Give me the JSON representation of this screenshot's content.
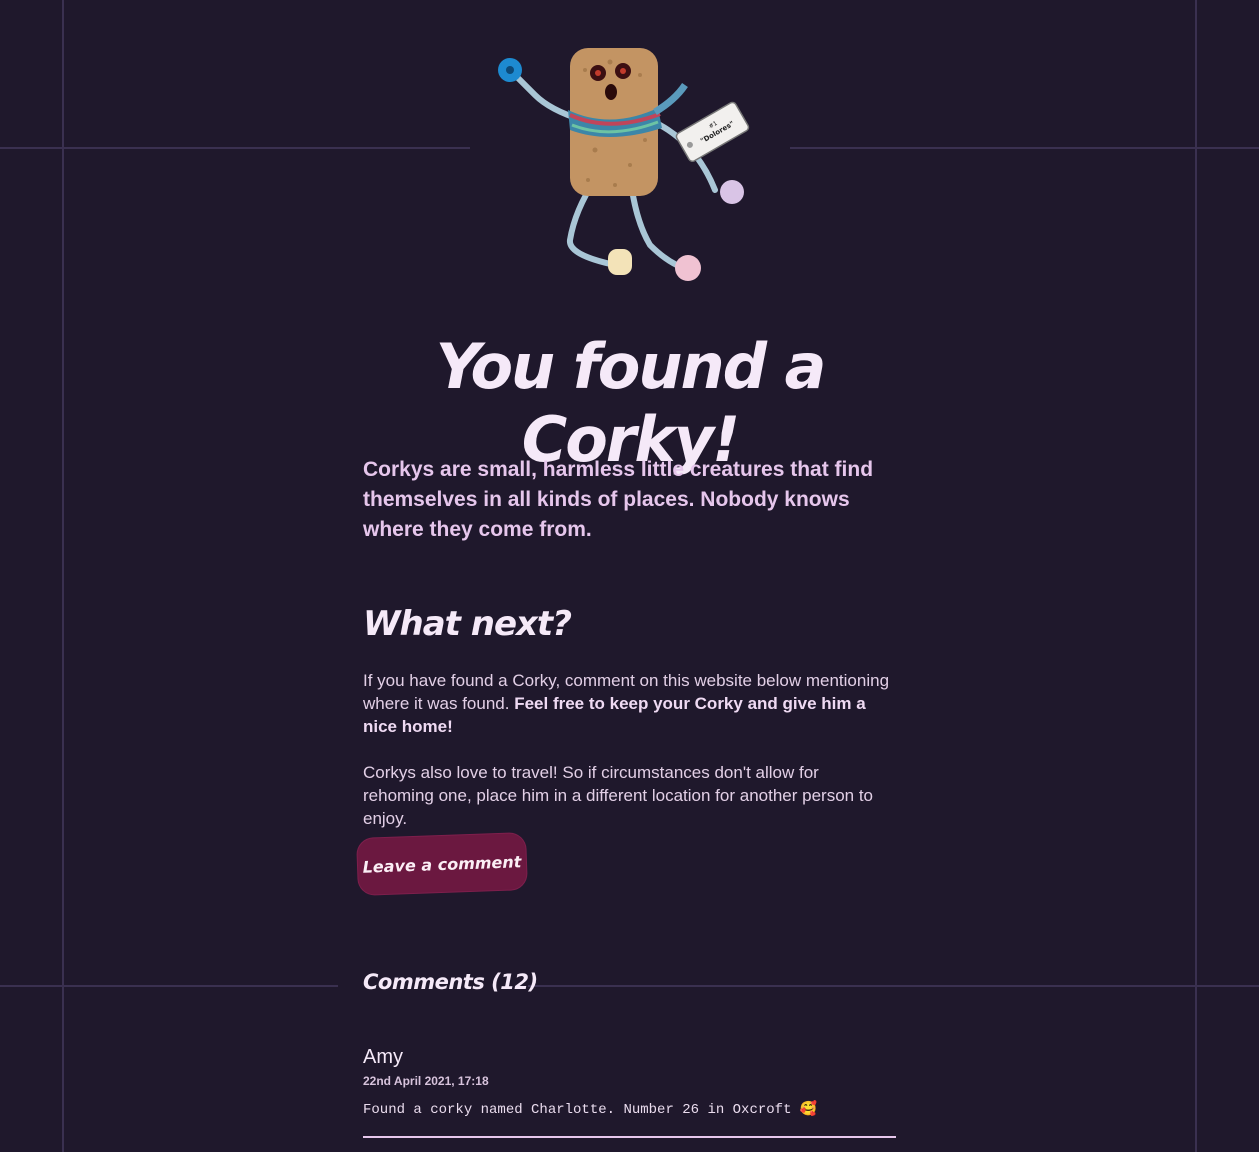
{
  "hero": {
    "title": "You found a Corky!",
    "mascot_icon": "corky-mascot-icon",
    "tag_text": "\"Dolores\"",
    "tag_number": "#1"
  },
  "lead": "Corkys are small, harmless little creatures that find themselves in all kinds of places. Nobody knows where they come from.",
  "what_next": {
    "title": "What next?",
    "para1_plain": "If you have found a Corky, comment on this website below mentioning where it was found. ",
    "para1_bold": "Feel free to keep your Corky and give him a nice home!",
    "para2": "Corkys also love to travel! So if circumstances don't allow for rehoming one, place him in a different location for another person to enjoy."
  },
  "actions": {
    "leave_comment_label": "Leave a comment"
  },
  "comments": {
    "title": "Comments (12)",
    "items": [
      {
        "author": "Amy",
        "date": "22nd April 2021, 17:18",
        "text": "Found a corky named Charlotte. Number 26 in Oxcroft 🥰"
      }
    ]
  },
  "colors": {
    "background": "#1f182c",
    "grid": "#3a3050",
    "accent_button": "#6b1840",
    "text_light": "#f5e9f8",
    "text_lead": "#e6c6ec"
  }
}
